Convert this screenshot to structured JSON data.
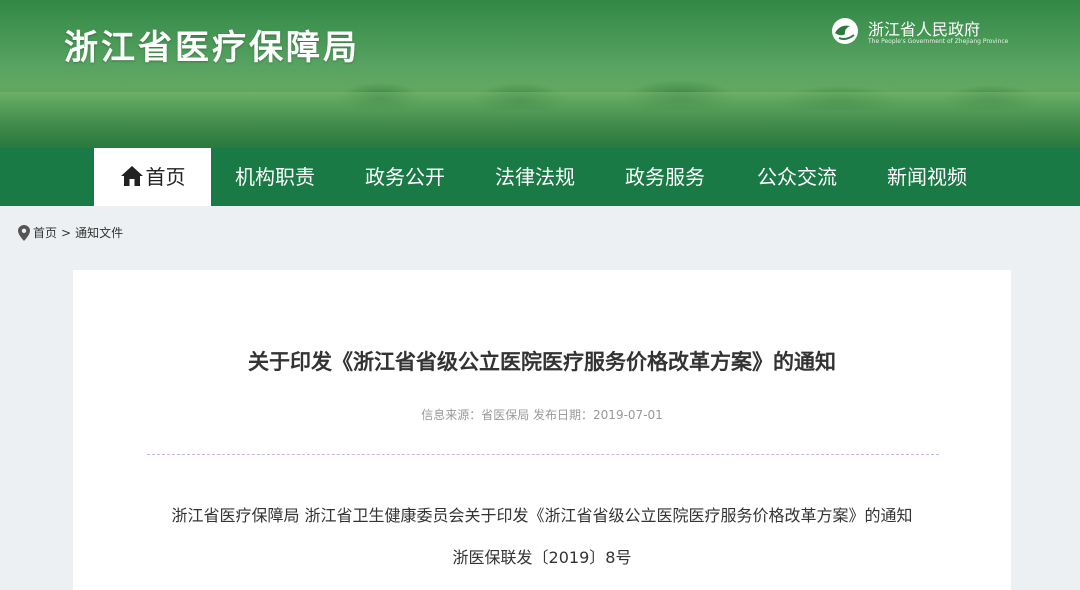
{
  "header": {
    "site_title": "浙江省医疗保障局",
    "gov_name": "浙江省人民政府",
    "gov_subtitle": "The People's Government of Zhejiang Province"
  },
  "nav": {
    "items": [
      {
        "label": "首页",
        "active": true
      },
      {
        "label": "机构职责"
      },
      {
        "label": "政务公开"
      },
      {
        "label": "法律法规"
      },
      {
        "label": "政务服务"
      },
      {
        "label": "公众交流"
      },
      {
        "label": "新闻视频"
      }
    ]
  },
  "breadcrumb": {
    "home": "首页",
    "separator": ">",
    "current": "通知文件"
  },
  "article": {
    "title": "关于印发《浙江省省级公立医院医疗服务价格改革方案》的通知",
    "meta": "信息来源：省医保局 发布日期：2019-07-01",
    "lines": [
      "浙江省医疗保障局 浙江省卫生健康委员会关于印发《浙江省省级公立医院医疗服务价格改革方案》的通知",
      "浙医保联发〔2019〕8号"
    ]
  },
  "colors": {
    "nav_bg": "#1a7a46",
    "banner_green": "#3e9648",
    "page_bg": "#edf0f2"
  },
  "icons": {
    "home": "home-icon",
    "location": "map-pin-icon",
    "emblem": "gov-emblem-icon"
  }
}
